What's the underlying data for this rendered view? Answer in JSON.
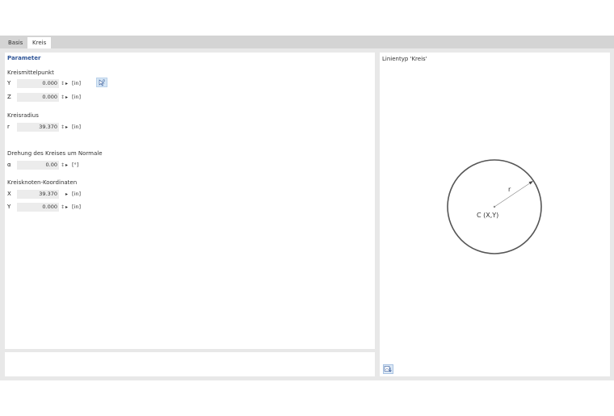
{
  "tabs": [
    {
      "label": "Basis"
    },
    {
      "label": "Kreis"
    }
  ],
  "parameters": {
    "title": "Parameter",
    "center": {
      "label": "Kreismittelpunkt",
      "rows": [
        {
          "symbol": "Y",
          "value": "0.000",
          "unit": "[in]"
        },
        {
          "symbol": "Z",
          "value": "0.000",
          "unit": "[in]"
        }
      ]
    },
    "radius": {
      "label": "Kreisradius",
      "rows": [
        {
          "symbol": "r",
          "value": "39.370",
          "unit": "[in]"
        }
      ]
    },
    "rotation": {
      "label": "Drehung des Kreises um Normale",
      "rows": [
        {
          "symbol": "α",
          "value": "0.00",
          "unit": "[°]"
        }
      ]
    },
    "node": {
      "label": "Kreisknoten-Koordinaten",
      "rows": [
        {
          "symbol": "X",
          "value": "39.370",
          "unit": "[in]"
        },
        {
          "symbol": "Y",
          "value": "0.000",
          "unit": "[in]"
        }
      ]
    }
  },
  "diagram": {
    "title": "Linientyp 'Kreis'",
    "center_label": "C (X,Y)",
    "radius_label": "r"
  },
  "icons": {
    "spin": "↕",
    "arrow": "▸"
  },
  "colors": {
    "accent": "#2f5597",
    "circle": "#555555",
    "field_bg": "#ececec"
  }
}
